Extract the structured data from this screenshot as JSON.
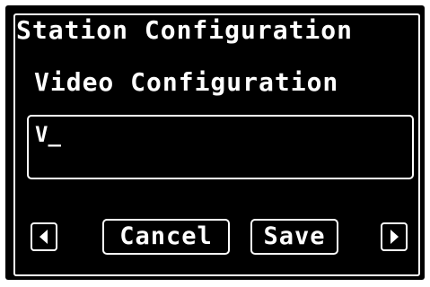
{
  "window": {
    "title": "Station Configuration",
    "subtitle": "Video Configuration"
  },
  "input": {
    "value": "V_"
  },
  "buttons": {
    "prev_icon": "left-arrow-icon",
    "cancel_label": "Cancel",
    "save_label": "Save",
    "next_icon": "right-arrow-icon"
  },
  "colors": {
    "background": "#000000",
    "foreground": "#ffffff"
  }
}
